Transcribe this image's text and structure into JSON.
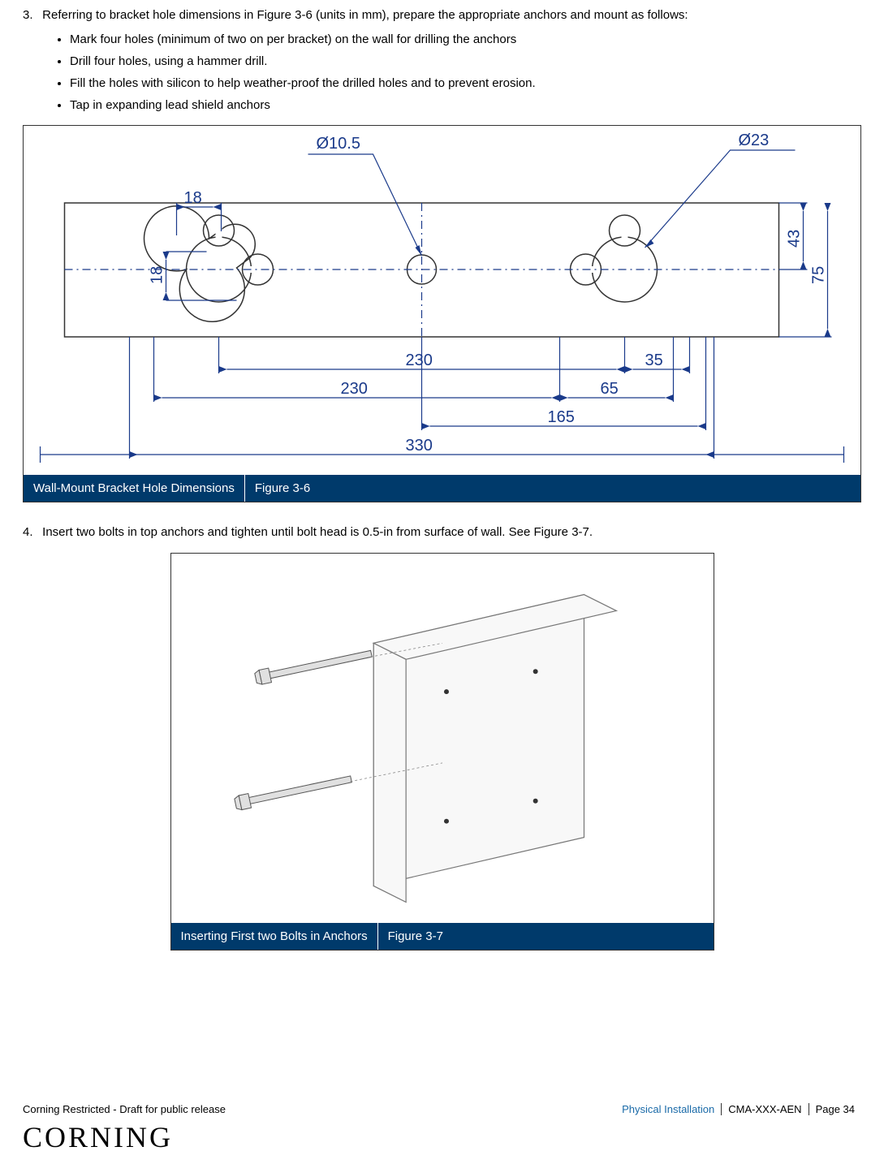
{
  "step3": {
    "num": "3.",
    "text": "Referring to bracket hole dimensions in Figure 3-6 (units in mm), prepare the appropriate anchors and mount as follows:",
    "bullets": [
      "Mark four holes (minimum of two on per bracket) on the wall for drilling the anchors",
      "Drill four holes, using a hammer drill.",
      "Fill the holes with silicon to help weather-proof the drilled holes and to prevent erosion.",
      "Tap in expanding lead shield anchors"
    ]
  },
  "figure1": {
    "caption": "Wall-Mount Bracket Hole Dimensions",
    "number": "Figure 3-6",
    "dims": {
      "d1": "Ø10.5",
      "d2": "Ø23",
      "w18": "18",
      "h18": "18",
      "h43": "43",
      "h75": "75",
      "w230a": "230",
      "w230b": "230",
      "w35": "35",
      "w65": "65",
      "w165": "165",
      "w330": "330"
    }
  },
  "step4": {
    "num": "4.",
    "text": "Insert two bolts in top anchors and tighten until bolt head is 0.5-in from surface of wall. See Figure 3-7."
  },
  "figure2": {
    "caption": "Inserting First two Bolts in Anchors",
    "number": "Figure 3-7"
  },
  "footer": {
    "left": "Corning Restricted - Draft for public release",
    "section": "Physical Installation",
    "doc": "CMA-XXX-AEN",
    "page": "Page 34",
    "logo": "CORNING"
  }
}
